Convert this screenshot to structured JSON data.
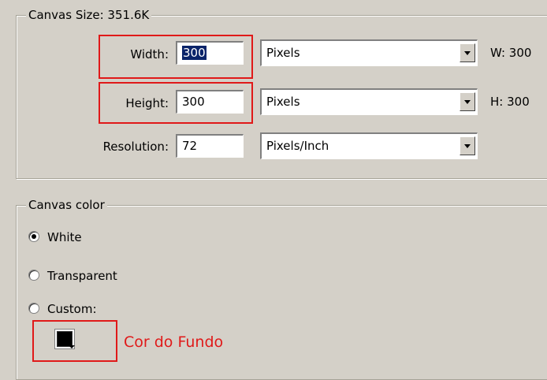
{
  "canvas_size": {
    "title": "Canvas Size: 351.6K",
    "width": {
      "label": "Width:",
      "value": "300",
      "unit": "Pixels",
      "readout": "W: 300"
    },
    "height": {
      "label": "Height:",
      "value": "300",
      "unit": "Pixels",
      "readout": "H: 300"
    },
    "resolution": {
      "label": "Resolution:",
      "value": "72",
      "unit": "Pixels/Inch"
    }
  },
  "canvas_color": {
    "title": "Canvas color",
    "options": [
      {
        "label": "White",
        "selected": true
      },
      {
        "label": "Transparent",
        "selected": false
      },
      {
        "label": "Custom:",
        "selected": false
      }
    ],
    "swatch_color": "#000000",
    "annotation": "Cor do Fundo"
  },
  "colors": {
    "highlight": "#e01919",
    "selection": "#0a246a",
    "dialog_bg": "#d4d0c8"
  }
}
